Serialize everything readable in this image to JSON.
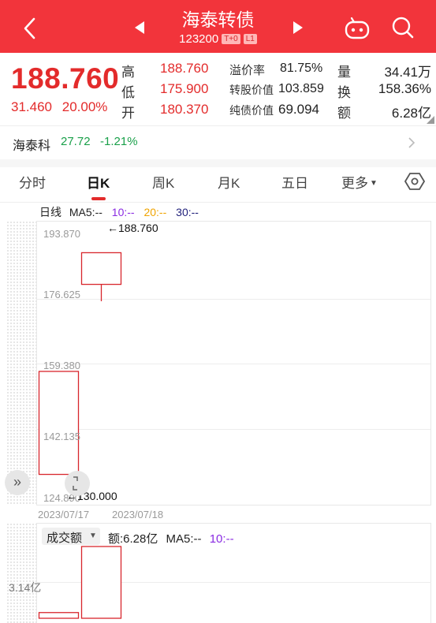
{
  "header": {
    "title": "海泰转债",
    "code": "123200",
    "badge_t0": "T+0",
    "badge_l1": "L1"
  },
  "quote": {
    "price": "188.760",
    "change": "31.460",
    "change_pct": "20.00%",
    "fields": {
      "high_label": "高",
      "high": "188.760",
      "low_label": "低",
      "low": "175.900",
      "open_label": "开",
      "open": "180.370",
      "premium_label": "溢价率",
      "premium": "81.75%",
      "conv_value_label": "转股价值",
      "conv_value": "103.859",
      "bond_value_label": "纯债价值",
      "bond_value": "69.094",
      "volume_label": "量",
      "volume": "34.41万",
      "turnover_label": "换",
      "turnover": "158.36%",
      "amount_label": "额",
      "amount": "6.28亿"
    }
  },
  "related": {
    "name": "海泰科",
    "price": "27.72",
    "change_pct": "-1.21%"
  },
  "tabs": [
    "分时",
    "日K",
    "周K",
    "月K",
    "五日",
    "更多"
  ],
  "active_tab": "日K",
  "chart": {
    "ma_line_label": "日线",
    "ma5": "MA5:--",
    "ma10": "10:--",
    "ma20": "20:--",
    "ma30": "30:--",
    "high_marker": "←188.760",
    "low_marker": "←130.000",
    "dates": [
      "2023/07/17",
      "2023/07/18"
    ],
    "colors": {
      "up": "#d8262c",
      "ma10": "#8a2be2",
      "ma20": "#f0a400",
      "ma30": "#1f1f7a"
    }
  },
  "volume": {
    "selector_label": "成交额",
    "amount_text": "额:6.28亿",
    "ma5": "MA5:--",
    "ma10": "10:--",
    "axis_label": "3.14亿"
  },
  "chart_data": {
    "type": "candlestick",
    "ylim": [
      124.89,
      193.87
    ],
    "y_ticks": [
      "193.870",
      "176.625",
      "159.380",
      "142.135",
      "124.890"
    ],
    "categories": [
      "2023/07/17",
      "2023/07/18"
    ],
    "open": [
      130.0,
      180.37
    ],
    "close": [
      157.3,
      188.76
    ],
    "high": [
      157.3,
      188.76
    ],
    "low": [
      130.0,
      175.9
    ],
    "volume_amount_yi": [
      0.5,
      6.28
    ],
    "volume_axis_label": "3.14亿"
  }
}
